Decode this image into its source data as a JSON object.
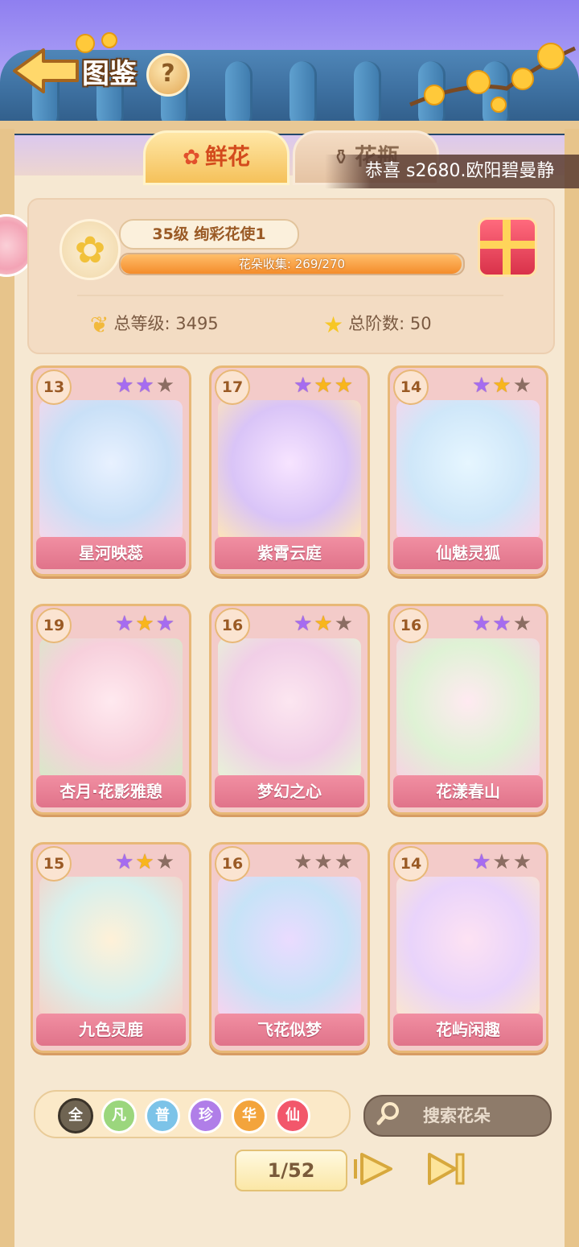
{
  "header": {
    "title": "图鉴",
    "help_label": "?"
  },
  "tabs": [
    {
      "label": "鲜花",
      "active": true
    },
    {
      "label": "花瓶",
      "active": false
    }
  ],
  "marquee": {
    "text": "恭喜  s2680.欧阳碧曼静  "
  },
  "stats": {
    "level_title": "35级  绚彩花使1",
    "collection_label": "花朵收集: 269/270",
    "collection_fraction": 0.9963,
    "total_level_label": "总等级: 3495",
    "total_rank_label": "总阶数: 50"
  },
  "cards": [
    {
      "level": "13",
      "name": "星河映蕊",
      "stars": [
        "purple",
        "purple",
        "empty"
      ]
    },
    {
      "level": "17",
      "name": "紫霄云庭",
      "stars": [
        "purple",
        "gold",
        "gold"
      ]
    },
    {
      "level": "14",
      "name": "仙魅灵狐",
      "stars": [
        "purple",
        "gold",
        "empty"
      ]
    },
    {
      "level": "19",
      "name": "杏月·花影雅憩",
      "stars": [
        "purple",
        "gold",
        "purple"
      ]
    },
    {
      "level": "16",
      "name": "梦幻之心",
      "stars": [
        "purple",
        "gold",
        "empty"
      ]
    },
    {
      "level": "16",
      "name": "花漾春山",
      "stars": [
        "purple",
        "purple",
        "empty"
      ]
    },
    {
      "level": "15",
      "name": "九色灵鹿",
      "stars": [
        "purple",
        "gold",
        "empty"
      ]
    },
    {
      "level": "16",
      "name": "飞花似梦",
      "stars": [
        "empty",
        "empty",
        "empty"
      ]
    },
    {
      "level": "14",
      "name": "花屿闲趣",
      "stars": [
        "purple",
        "empty",
        "empty"
      ]
    }
  ],
  "filters": [
    {
      "label": "全",
      "color": "#6f6452",
      "selected": true
    },
    {
      "label": "凡",
      "color": "#9bd67d",
      "selected": false
    },
    {
      "label": "普",
      "color": "#7cc3e8",
      "selected": false
    },
    {
      "label": "珍",
      "color": "#b07ee8",
      "selected": false
    },
    {
      "label": "华",
      "color": "#f3a43c",
      "selected": false
    },
    {
      "label": "仙",
      "color": "#f2576b",
      "selected": false
    }
  ],
  "search": {
    "label": "搜索花朵"
  },
  "pagination": {
    "label": "1/52"
  }
}
